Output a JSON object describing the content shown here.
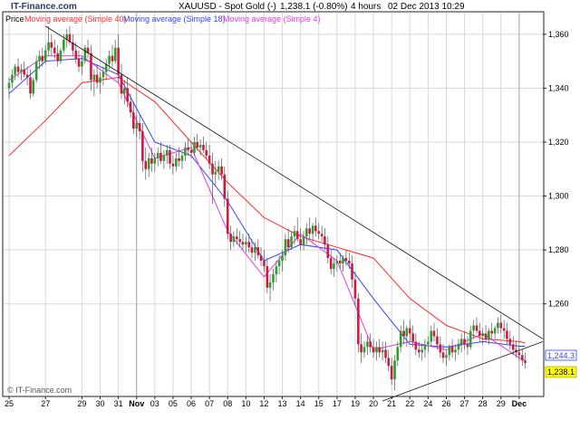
{
  "header": {
    "brand": "IT-Finance.com",
    "title": "XAUUSD - Spot Gold (-)",
    "last_change": "1,238.1 (-0.80%)",
    "timeframe": "4 hours",
    "datetime": "02 Dec 2013 10:29"
  },
  "legend": {
    "price": "Price",
    "ma40": "Moving average (Simple 40)",
    "ma18": "Moving average (Simple 18)",
    "ma4": "Moving average (Simple 4)"
  },
  "watermark": "© IT-Finance.com",
  "colors": {
    "bg": "#ffffff",
    "frame": "#222222",
    "grid": "#d9d9d9",
    "up_candle": "#2e9f2e",
    "down_candle": "#d0193f",
    "ma40": "#ff2a2a",
    "ma18": "#3345ff",
    "ma4": "#e23ce2",
    "trendline": "#111111",
    "last_price_bg": "#ffff00",
    "ma_label_bg": "#ffffff"
  },
  "chart_data": {
    "type": "candlestick",
    "ylim": [
      1226,
      1368
    ],
    "y_ticks": [
      {
        "value": 1360,
        "label": "1,360"
      },
      {
        "value": 1340,
        "label": "1,340"
      },
      {
        "value": 1320,
        "label": "1,320"
      },
      {
        "value": 1300,
        "label": "1,300"
      },
      {
        "value": 1280,
        "label": "1,280"
      },
      {
        "value": 1260,
        "label": "1,260"
      }
    ],
    "x_ticks": [
      {
        "day": 0,
        "label": "25"
      },
      {
        "day": 2,
        "label": "27"
      },
      {
        "day": 4,
        "label": "29"
      },
      {
        "day": 5,
        "label": "30"
      },
      {
        "day": 6,
        "label": "31"
      },
      {
        "day": 7,
        "label": "Nov",
        "bold": true
      },
      {
        "day": 8,
        "label": "03"
      },
      {
        "day": 9,
        "label": "05"
      },
      {
        "day": 10,
        "label": "06"
      },
      {
        "day": 11,
        "label": "07"
      },
      {
        "day": 12,
        "label": "08"
      },
      {
        "day": 13,
        "label": "10"
      },
      {
        "day": 14,
        "label": "12"
      },
      {
        "day": 15,
        "label": "13"
      },
      {
        "day": 16,
        "label": "14"
      },
      {
        "day": 17,
        "label": "15"
      },
      {
        "day": 18,
        "label": "17"
      },
      {
        "day": 19,
        "label": "19"
      },
      {
        "day": 20,
        "label": "20"
      },
      {
        "day": 21,
        "label": "21"
      },
      {
        "day": 22,
        "label": "22"
      },
      {
        "day": 23,
        "label": "24"
      },
      {
        "day": 24,
        "label": "26"
      },
      {
        "day": 25,
        "label": "27"
      },
      {
        "day": 26,
        "label": "28"
      },
      {
        "day": 27,
        "label": "29"
      },
      {
        "day": 28,
        "label": "Dec",
        "bold": true
      }
    ],
    "x_range_days": [
      0,
      29.3
    ],
    "candles": [
      [
        0.0,
        1340,
        1344,
        1336,
        1342
      ],
      [
        0.17,
        1342,
        1347,
        1340,
        1345
      ],
      [
        0.33,
        1345,
        1349,
        1343,
        1348
      ],
      [
        0.5,
        1348,
        1351,
        1344,
        1346
      ],
      [
        0.67,
        1346,
        1349,
        1343,
        1347
      ],
      [
        0.83,
        1347,
        1350,
        1344,
        1345
      ],
      [
        1.0,
        1345,
        1348,
        1341,
        1344
      ],
      [
        1.17,
        1344,
        1347,
        1336,
        1338
      ],
      [
        1.33,
        1338,
        1344,
        1337,
        1343
      ],
      [
        1.5,
        1343,
        1352,
        1342,
        1350
      ],
      [
        1.67,
        1350,
        1354,
        1347,
        1352
      ],
      [
        1.83,
        1352,
        1355,
        1348,
        1350
      ],
      [
        2.0,
        1350,
        1356,
        1349,
        1354
      ],
      [
        2.17,
        1354,
        1363,
        1352,
        1357
      ],
      [
        2.33,
        1357,
        1360,
        1352,
        1355
      ],
      [
        2.5,
        1355,
        1358,
        1351,
        1353
      ],
      [
        2.67,
        1353,
        1356,
        1348,
        1350
      ],
      [
        2.83,
        1350,
        1355,
        1349,
        1354
      ],
      [
        3.0,
        1354,
        1360,
        1353,
        1358
      ],
      [
        3.17,
        1358,
        1362,
        1355,
        1360
      ],
      [
        3.33,
        1360,
        1363,
        1356,
        1357
      ],
      [
        3.5,
        1357,
        1360,
        1352,
        1354
      ],
      [
        3.67,
        1354,
        1357,
        1349,
        1351
      ],
      [
        3.83,
        1351,
        1354,
        1346,
        1348
      ],
      [
        4.0,
        1348,
        1352,
        1345,
        1350
      ],
      [
        4.17,
        1350,
        1356,
        1349,
        1355
      ],
      [
        4.33,
        1355,
        1358,
        1351,
        1353
      ],
      [
        4.5,
        1353,
        1356,
        1339,
        1343
      ],
      [
        4.67,
        1343,
        1347,
        1337,
        1345
      ],
      [
        4.83,
        1345,
        1349,
        1340,
        1342
      ],
      [
        5.0,
        1342,
        1346,
        1338,
        1344
      ],
      [
        5.17,
        1344,
        1348,
        1341,
        1346
      ],
      [
        5.33,
        1346,
        1351,
        1343,
        1349
      ],
      [
        5.5,
        1349,
        1354,
        1347,
        1352
      ],
      [
        5.67,
        1352,
        1356,
        1348,
        1350
      ],
      [
        5.83,
        1350,
        1358,
        1349,
        1355
      ],
      [
        6.0,
        1355,
        1360,
        1342,
        1345
      ],
      [
        6.17,
        1345,
        1349,
        1336,
        1338
      ],
      [
        6.33,
        1338,
        1343,
        1334,
        1340
      ],
      [
        6.5,
        1340,
        1344,
        1333,
        1335
      ],
      [
        6.67,
        1335,
        1338,
        1329,
        1331
      ],
      [
        6.83,
        1331,
        1335,
        1323,
        1325
      ],
      [
        7.0,
        1325,
        1330,
        1322,
        1327
      ],
      [
        7.17,
        1327,
        1330,
        1321,
        1324
      ],
      [
        7.33,
        1324,
        1327,
        1309,
        1313
      ],
      [
        7.5,
        1313,
        1318,
        1306,
        1310
      ],
      [
        7.67,
        1310,
        1316,
        1307,
        1314
      ],
      [
        7.83,
        1314,
        1318,
        1309,
        1312
      ],
      [
        8.0,
        1312,
        1316,
        1309,
        1314
      ],
      [
        8.17,
        1314,
        1318,
        1311,
        1316
      ],
      [
        8.33,
        1316,
        1320,
        1312,
        1313
      ],
      [
        8.5,
        1313,
        1317,
        1310,
        1315
      ],
      [
        8.67,
        1315,
        1319,
        1312,
        1317
      ],
      [
        8.83,
        1317,
        1319,
        1310,
        1312
      ],
      [
        9.0,
        1312,
        1315,
        1308,
        1311
      ],
      [
        9.17,
        1311,
        1316,
        1309,
        1314
      ],
      [
        9.33,
        1314,
        1318,
        1311,
        1313
      ],
      [
        9.5,
        1313,
        1316,
        1310,
        1315
      ],
      [
        9.67,
        1315,
        1320,
        1313,
        1318
      ],
      [
        9.83,
        1318,
        1321,
        1315,
        1317
      ],
      [
        10.0,
        1317,
        1320,
        1314,
        1316
      ],
      [
        10.17,
        1316,
        1322,
        1315,
        1320
      ],
      [
        10.33,
        1320,
        1323,
        1317,
        1318
      ],
      [
        10.5,
        1318,
        1321,
        1315,
        1319
      ],
      [
        10.67,
        1319,
        1322,
        1316,
        1317
      ],
      [
        10.83,
        1317,
        1320,
        1314,
        1315
      ],
      [
        11.0,
        1315,
        1319,
        1310,
        1312
      ],
      [
        11.17,
        1312,
        1316,
        1297,
        1308
      ],
      [
        11.33,
        1308,
        1313,
        1304,
        1309
      ],
      [
        11.5,
        1309,
        1313,
        1306,
        1311
      ],
      [
        11.67,
        1311,
        1314,
        1306,
        1308
      ],
      [
        11.83,
        1308,
        1311,
        1296,
        1299
      ],
      [
        12.0,
        1299,
        1302,
        1284,
        1286
      ],
      [
        12.17,
        1286,
        1289,
        1280,
        1283
      ],
      [
        12.33,
        1283,
        1287,
        1281,
        1285
      ],
      [
        12.5,
        1285,
        1288,
        1282,
        1284
      ],
      [
        12.67,
        1284,
        1287,
        1281,
        1283
      ],
      [
        12.83,
        1283,
        1286,
        1280,
        1282
      ],
      [
        13.0,
        1282,
        1285,
        1279,
        1283
      ],
      [
        13.17,
        1283,
        1286,
        1279,
        1281
      ],
      [
        13.33,
        1281,
        1284,
        1277,
        1279
      ],
      [
        13.5,
        1279,
        1283,
        1276,
        1281
      ],
      [
        13.67,
        1281,
        1284,
        1277,
        1278
      ],
      [
        13.83,
        1278,
        1281,
        1274,
        1276
      ],
      [
        14.0,
        1276,
        1280,
        1272,
        1274
      ],
      [
        14.17,
        1274,
        1277,
        1264,
        1266
      ],
      [
        14.33,
        1266,
        1271,
        1261,
        1268
      ],
      [
        14.5,
        1268,
        1273,
        1265,
        1271
      ],
      [
        14.67,
        1271,
        1276,
        1268,
        1274
      ],
      [
        14.83,
        1274,
        1278,
        1271,
        1276
      ],
      [
        15.0,
        1276,
        1280,
        1272,
        1278
      ],
      [
        15.17,
        1278,
        1286,
        1276,
        1284
      ],
      [
        15.33,
        1284,
        1288,
        1279,
        1281
      ],
      [
        15.5,
        1281,
        1287,
        1280,
        1285
      ],
      [
        15.67,
        1285,
        1289,
        1282,
        1287
      ],
      [
        15.83,
        1287,
        1292,
        1283,
        1284
      ],
      [
        16.0,
        1284,
        1288,
        1280,
        1282
      ],
      [
        16.17,
        1282,
        1287,
        1280,
        1285
      ],
      [
        16.33,
        1285,
        1290,
        1282,
        1288
      ],
      [
        16.5,
        1288,
        1292,
        1284,
        1286
      ],
      [
        16.67,
        1286,
        1290,
        1283,
        1289
      ],
      [
        16.83,
        1289,
        1292,
        1285,
        1287
      ],
      [
        17.0,
        1287,
        1290,
        1284,
        1286
      ],
      [
        17.17,
        1286,
        1289,
        1283,
        1285
      ],
      [
        17.33,
        1285,
        1288,
        1280,
        1282
      ],
      [
        17.5,
        1282,
        1285,
        1275,
        1277
      ],
      [
        17.67,
        1277,
        1280,
        1271,
        1273
      ],
      [
        17.83,
        1273,
        1277,
        1270,
        1275
      ],
      [
        18.0,
        1275,
        1278,
        1272,
        1276
      ],
      [
        18.17,
        1276,
        1279,
        1273,
        1275
      ],
      [
        18.33,
        1275,
        1278,
        1272,
        1277
      ],
      [
        18.5,
        1277,
        1280,
        1274,
        1276
      ],
      [
        18.67,
        1276,
        1279,
        1273,
        1275
      ],
      [
        18.83,
        1275,
        1278,
        1266,
        1269
      ],
      [
        19.0,
        1269,
        1272,
        1259,
        1262
      ],
      [
        19.17,
        1262,
        1264,
        1242,
        1245
      ],
      [
        19.33,
        1245,
        1249,
        1238,
        1242
      ],
      [
        19.5,
        1242,
        1246,
        1240,
        1244
      ],
      [
        19.67,
        1244,
        1248,
        1241,
        1246
      ],
      [
        19.83,
        1246,
        1249,
        1242,
        1244
      ],
      [
        20.0,
        1244,
        1247,
        1240,
        1242
      ],
      [
        20.17,
        1242,
        1246,
        1239,
        1244
      ],
      [
        20.33,
        1244,
        1247,
        1240,
        1242
      ],
      [
        20.5,
        1242,
        1246,
        1239,
        1243
      ],
      [
        20.67,
        1243,
        1246,
        1238,
        1240
      ],
      [
        20.83,
        1240,
        1243,
        1235,
        1237
      ],
      [
        21.0,
        1237,
        1240,
        1230,
        1232
      ],
      [
        21.17,
        1232,
        1241,
        1228,
        1239
      ],
      [
        21.33,
        1239,
        1246,
        1237,
        1244
      ],
      [
        21.5,
        1244,
        1252,
        1242,
        1250
      ],
      [
        21.67,
        1250,
        1254,
        1245,
        1248
      ],
      [
        21.83,
        1248,
        1252,
        1244,
        1251
      ],
      [
        22.0,
        1251,
        1254,
        1246,
        1249
      ],
      [
        22.17,
        1249,
        1252,
        1244,
        1246
      ],
      [
        22.33,
        1246,
        1249,
        1241,
        1243
      ],
      [
        22.5,
        1243,
        1246,
        1240,
        1242
      ],
      [
        22.67,
        1242,
        1245,
        1239,
        1243
      ],
      [
        22.83,
        1243,
        1247,
        1240,
        1245
      ],
      [
        23.0,
        1245,
        1248,
        1242,
        1246
      ],
      [
        23.17,
        1246,
        1252,
        1244,
        1250
      ],
      [
        23.33,
        1250,
        1253,
        1246,
        1248
      ],
      [
        23.5,
        1248,
        1251,
        1243,
        1245
      ],
      [
        23.67,
        1245,
        1248,
        1240,
        1242
      ],
      [
        23.83,
        1242,
        1245,
        1238,
        1240
      ],
      [
        24.0,
        1240,
        1243,
        1237,
        1241
      ],
      [
        24.17,
        1241,
        1245,
        1239,
        1244
      ],
      [
        24.33,
        1244,
        1247,
        1240,
        1242
      ],
      [
        24.5,
        1242,
        1245,
        1239,
        1243
      ],
      [
        24.67,
        1243,
        1247,
        1241,
        1245
      ],
      [
        24.83,
        1245,
        1249,
        1242,
        1247
      ],
      [
        25.0,
        1247,
        1250,
        1243,
        1245
      ],
      [
        25.17,
        1245,
        1248,
        1241,
        1244
      ],
      [
        25.33,
        1244,
        1252,
        1243,
        1250
      ],
      [
        25.5,
        1250,
        1254,
        1247,
        1252
      ],
      [
        25.67,
        1252,
        1255,
        1249,
        1250
      ],
      [
        25.83,
        1250,
        1253,
        1246,
        1248
      ],
      [
        26.0,
        1248,
        1251,
        1245,
        1249
      ],
      [
        26.17,
        1249,
        1252,
        1246,
        1247
      ],
      [
        26.33,
        1247,
        1251,
        1245,
        1250
      ],
      [
        26.5,
        1250,
        1253,
        1247,
        1249
      ],
      [
        26.67,
        1249,
        1252,
        1247,
        1251
      ],
      [
        26.83,
        1251,
        1255,
        1249,
        1253
      ],
      [
        27.0,
        1253,
        1256,
        1249,
        1251
      ],
      [
        27.17,
        1251,
        1254,
        1247,
        1250
      ],
      [
        27.33,
        1250,
        1253,
        1245,
        1247
      ],
      [
        27.5,
        1247,
        1250,
        1243,
        1245
      ],
      [
        27.67,
        1245,
        1248,
        1241,
        1243
      ],
      [
        27.83,
        1243,
        1246,
        1240,
        1242
      ],
      [
        28.0,
        1242,
        1244,
        1239,
        1241
      ],
      [
        28.17,
        1241,
        1243,
        1237,
        1239
      ],
      [
        28.33,
        1239,
        1242,
        1236,
        1238.1
      ]
    ],
    "trendlines": [
      {
        "from": [
          2.0,
          1363
        ],
        "to": [
          29.3,
          1247
        ]
      },
      {
        "from": [
          20.5,
          1224
        ],
        "to": [
          29.3,
          1246
        ]
      }
    ],
    "series": [
      {
        "name": "Moving average (Simple 40)",
        "x": [
          0,
          2,
          4,
          6,
          8,
          10,
          12,
          14,
          16,
          18,
          20,
          22,
          24,
          26,
          28,
          28.33
        ],
        "values": [
          1315,
          1328,
          1342,
          1344,
          1335,
          1320,
          1305,
          1292,
          1285,
          1281,
          1277,
          1262,
          1252,
          1247,
          1246,
          1245.5
        ]
      },
      {
        "name": "Moving average (Simple 18)",
        "x": [
          0,
          2,
          4,
          6,
          8,
          10,
          12,
          14,
          16,
          18,
          20,
          22,
          24,
          26,
          28,
          28.33
        ],
        "values": [
          1338,
          1350,
          1351,
          1345,
          1320,
          1315,
          1298,
          1276,
          1282,
          1280,
          1262,
          1245,
          1244,
          1246,
          1244.3,
          1244.3
        ]
      },
      {
        "name": "Moving average (Simple 4)",
        "x": [
          0,
          2,
          4,
          6,
          8,
          10,
          12,
          14,
          16,
          18,
          20,
          22,
          24,
          26,
          28,
          28.33
        ],
        "values": [
          1343,
          1352,
          1352,
          1342,
          1314,
          1318,
          1287,
          1270,
          1286,
          1276,
          1243,
          1246,
          1243,
          1249,
          1240,
          1239
        ]
      }
    ],
    "last_price_label": "1,238.1",
    "ma_value_label": "1,244.3"
  }
}
